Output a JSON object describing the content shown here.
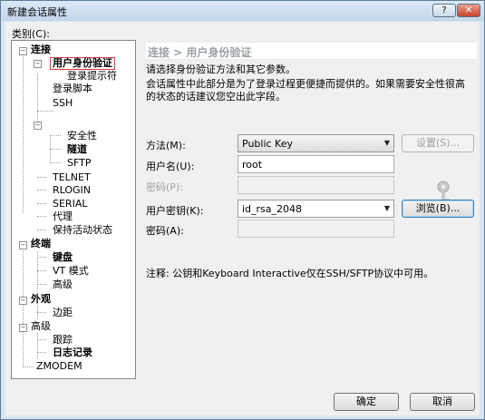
{
  "window": {
    "title": "新建会话属性",
    "help_label": "?",
    "close_label": "✕"
  },
  "category_label": "类别(C):",
  "tree": [
    {
      "label": "连接",
      "bold": true
    },
    {
      "label": "用户身份验证",
      "bold": true,
      "selected": true
    },
    {
      "label": "登录提示符"
    },
    {
      "label": "登录脚本"
    },
    {
      "label": "SSH"
    },
    {
      "label": "安全性"
    },
    {
      "label": "隧道",
      "bold": true
    },
    {
      "label": "SFTP"
    },
    {
      "label": "TELNET"
    },
    {
      "label": "RLOGIN"
    },
    {
      "label": "SERIAL"
    },
    {
      "label": "代理"
    },
    {
      "label": "保持活动状态"
    },
    {
      "label": "终端",
      "bold": true
    },
    {
      "label": "键盘",
      "bold": true
    },
    {
      "label": "VT 模式"
    },
    {
      "label": "高级"
    },
    {
      "label": "外观",
      "bold": true
    },
    {
      "label": "边距"
    },
    {
      "label": "高级"
    },
    {
      "label": "跟踪"
    },
    {
      "label": "日志记录",
      "bold": true
    },
    {
      "label": "ZMODEM"
    }
  ],
  "panel": {
    "heading": "连接 > 用户身份验证",
    "intro": "请选择身份验证方法和其它参数。",
    "desc_line1": "会话属性中此部分是为了登录过程更便捷而提供的。如果需要安全性很高",
    "desc_line2": "的状态的话建议您空出此字段。",
    "method_label": "方法(M):",
    "method_value": "Public Key",
    "settings_button": "设置(S)...",
    "username_label": "用户名(U):",
    "username_value": "root",
    "password_label": "密码(P):",
    "userkey_label": "用户密钥(K):",
    "userkey_value": "id_rsa_2048",
    "browse_button": "浏览(B)...",
    "passphrase_label": "密码(A):",
    "note": "注释: 公钥和Keyboard Interactive仅在SSH/SFTP协议中可用。"
  },
  "footer": {
    "ok": "确定",
    "cancel": "取消"
  },
  "icons": {
    "key": "key-icon"
  }
}
